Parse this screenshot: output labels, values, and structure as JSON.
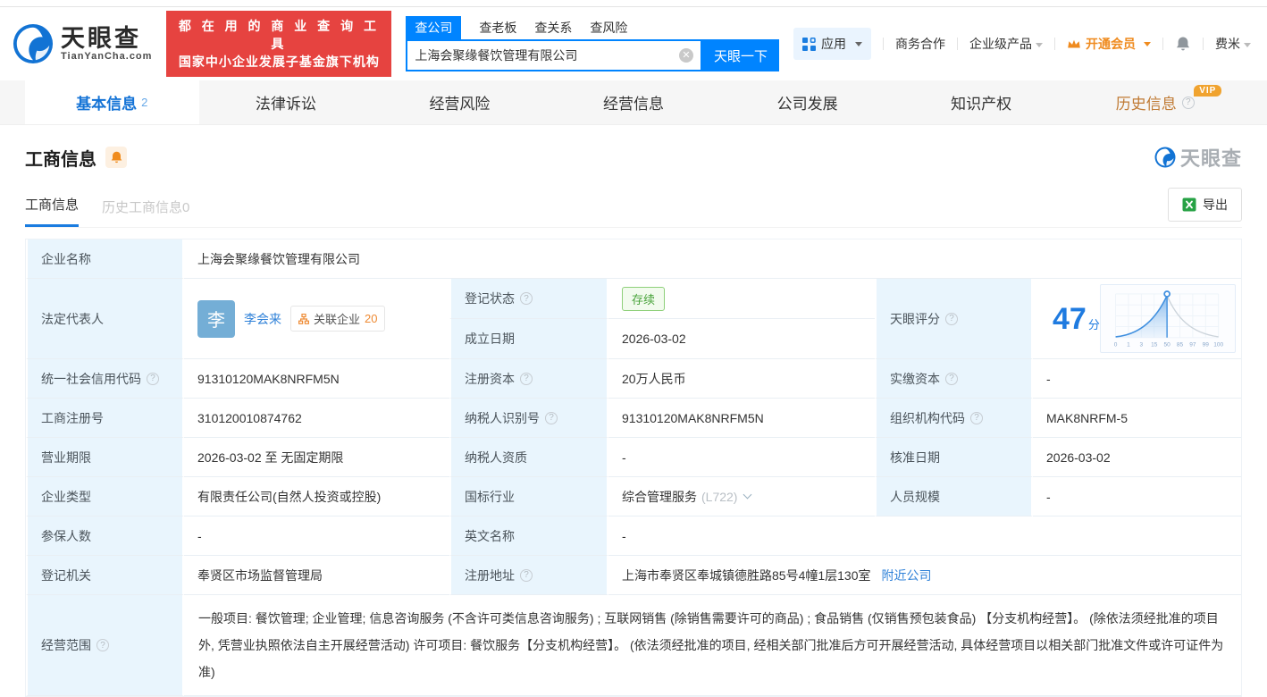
{
  "header": {
    "logo_title": "天眼查",
    "logo_domain": "TianYanCha.com",
    "slogan_line1": "都 在 用 的 商 业 查 询 工 具",
    "slogan_line2": "国家中小企业发展子基金旗下机构",
    "search_tabs": [
      {
        "label": "查公司",
        "active": true
      },
      {
        "label": "查老板",
        "active": false
      },
      {
        "label": "查关系",
        "active": false
      },
      {
        "label": "查风险",
        "active": false
      }
    ],
    "search_value": "上海会聚缘餐饮管理有限公司",
    "search_button": "天眼一下",
    "nav_apps": "应用",
    "nav_cooperation": "商务合作",
    "nav_enterprise": "企业级产品",
    "nav_vip": "开通会员",
    "nav_user": "费米"
  },
  "tabs": [
    {
      "label": "基本信息",
      "count": "2"
    },
    {
      "label": "法律诉讼"
    },
    {
      "label": "经营风险"
    },
    {
      "label": "经营信息"
    },
    {
      "label": "公司发展"
    },
    {
      "label": "知识产权"
    },
    {
      "label": "历史信息",
      "badge": "VIP"
    }
  ],
  "section": {
    "title": "工商信息",
    "watermark": "天眼查",
    "subtab_active": "工商信息",
    "subtab_history": "历史工商信息0",
    "export_label": "导出"
  },
  "info": {
    "name_label": "企业名称",
    "name": "上海会聚缘餐饮管理有限公司",
    "legal_rep_label": "法定代表人",
    "legal_rep_avatar": "李",
    "legal_rep": "李会来",
    "related_label": "关联企业",
    "related_count": "20",
    "reg_status_label": "登记状态",
    "reg_status": "存续",
    "est_date_label": "成立日期",
    "est_date": "2026-03-02",
    "score_label": "天眼评分",
    "score_value": "47",
    "score_unit": "分",
    "uscc_label": "统一社会信用代码",
    "uscc": "91310120MAK8NRFM5N",
    "reg_capital_label": "注册资本",
    "reg_capital": "20万人民币",
    "paid_capital_label": "实缴资本",
    "paid_capital": "-",
    "reg_no_label": "工商注册号",
    "reg_no": "310120010874762",
    "taxpayer_id_label": "纳税人识别号",
    "taxpayer_id": "91310120MAK8NRFM5N",
    "org_code_label": "组织机构代码",
    "org_code": "MAK8NRFM-5",
    "term_label": "营业期限",
    "term": "2026-03-02 至 无固定期限",
    "taxpayer_quality_label": "纳税人资质",
    "taxpayer_quality": "-",
    "approval_date_label": "核准日期",
    "approval_date": "2026-03-02",
    "company_type_label": "企业类型",
    "company_type": "有限责任公司(自然人投资或控股)",
    "industry_label": "国标行业",
    "industry": "综合管理服务",
    "industry_code": "(L722)",
    "staff_label": "人员规模",
    "staff": "-",
    "insured_label": "参保人数",
    "insured": "-",
    "en_name_label": "英文名称",
    "en_name": "-",
    "authority_label": "登记机关",
    "authority": "奉贤区市场监督管理局",
    "address_label": "注册地址",
    "address": "上海市奉贤区奉城镇德胜路85号4幢1层130室",
    "nearby_link": "附近公司",
    "scope_label": "经营范围",
    "scope": "一般项目: 餐饮管理; 企业管理; 信息咨询服务 (不含许可类信息咨询服务) ; 互联网销售 (除销售需要许可的商品) ; 食品销售 (仅销售预包装食品) 【分支机构经营】。 (除依法须经批准的项目外, 凭营业执照依法自主开展经营活动) 许可项目: 餐饮服务【分支机构经营】。 (依法须经批准的项目, 经相关部门批准后方可开展经营活动, 具体经营项目以相关部门批准文件或许可证件为准)"
  },
  "chart_data": {
    "type": "area",
    "title": "天眼评分",
    "score": 47,
    "x_ticks": [
      "0",
      "1",
      "3",
      "15",
      "50",
      "85",
      "97",
      "99",
      "100"
    ],
    "marker_at": "50",
    "curve": "bell distribution, blue filled left of marker at 50, gray to the right",
    "colors": {
      "curve_blue": "#3f8fdf",
      "curve_gray": "#ccd4db",
      "tick_text": "#8aa8cc"
    }
  },
  "colors": {
    "accent_blue": "#0084ff",
    "link_blue": "#2f81d8",
    "banner_red": "#e64340",
    "vip_orange": "#f0a32f",
    "status_green": "#48a33a",
    "label_cell_bg": "#e9f5fd"
  }
}
